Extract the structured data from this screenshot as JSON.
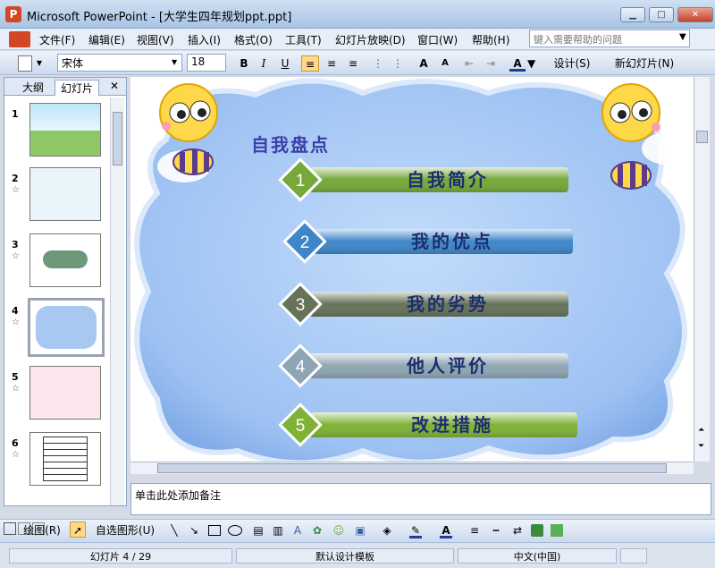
{
  "window": {
    "app_icon": "P",
    "title": "Microsoft PowerPoint - [大学生四年规划ppt.ppt]",
    "min": "▁",
    "max": "□",
    "close": "✕"
  },
  "menu": [
    "文件(F)",
    "编辑(E)",
    "视图(V)",
    "插入(I)",
    "格式(O)",
    "工具(T)",
    "幻灯片放映(D)",
    "窗口(W)",
    "帮助(H)"
  ],
  "help": {
    "placeholder": "键入需要帮助的问题"
  },
  "toolbar": {
    "font": "宋体",
    "size": "18",
    "bold": "B",
    "italic": "I",
    "underline": "U",
    "design": "设计(S)",
    "new_slide": "新幻灯片(N)"
  },
  "panel": {
    "tab_outline": "大纲",
    "tab_slides": "幻灯片",
    "close": "✕",
    "slides": [
      {
        "num": "1"
      },
      {
        "num": "2"
      },
      {
        "num": "3"
      },
      {
        "num": "4"
      },
      {
        "num": "5"
      },
      {
        "num": "6"
      }
    ]
  },
  "slide": {
    "heading": "自我盘点",
    "items": [
      {
        "num": "1",
        "label": "自我简介",
        "color": "#76a83a"
      },
      {
        "num": "2",
        "label": "我的优点",
        "color": "#3f86c9"
      },
      {
        "num": "3",
        "label": "我的劣势",
        "color": "#66735a"
      },
      {
        "num": "4",
        "label": "他人评价",
        "color": "#8fa5b3"
      },
      {
        "num": "5",
        "label": "改进措施",
        "color": "#7fb235"
      }
    ]
  },
  "notes": {
    "placeholder": "单击此处添加备注"
  },
  "draw": {
    "draw_label": "绘图(R)",
    "autoshape": "自选图形(U)"
  },
  "status": {
    "slide_info": "幻灯片 4 / 29",
    "template": "默认设计模板",
    "language": "中文(中国)"
  }
}
